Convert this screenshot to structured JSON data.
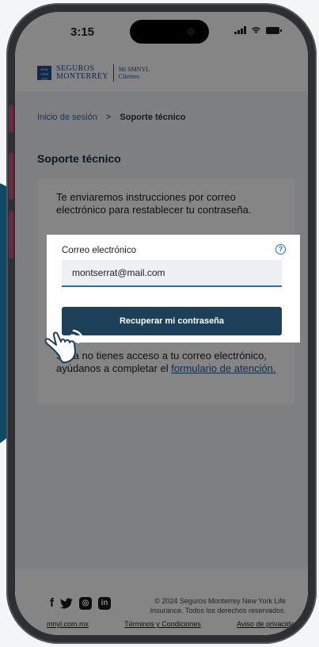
{
  "status_bar": {
    "time": "3:15"
  },
  "brand": {
    "logo_box": "NEW YORK LIFE",
    "name_line1": "SEGUROS",
    "name_line2": "MONTERREY",
    "product_line1": "Mi SMNYL",
    "product_line2": "Clientes"
  },
  "breadcrumb": {
    "home": "Inicio de sesión",
    "separator": ">",
    "current": "Soporte técnico"
  },
  "page": {
    "title": "Soporte técnico"
  },
  "card": {
    "intro": "Te enviaremos instrucciones por correo electrónico para restablecer tu contraseña.",
    "email_label": "Correo electrónico",
    "email_value": "montserrat@mail.com",
    "submit_label": "Recuperar mi contraseña",
    "help_text": "Si ya no tienes acceso a tu correo electrónico, ayúdanos a completar el ",
    "help_link": "formulario de atención."
  },
  "footer": {
    "copyright": "© 2024 Seguros Monterrey New York Life Insurance. Todos los derechos reservados.",
    "links": [
      "mnyl.com.mx",
      "Términos y Condiciones",
      "Aviso de privacidad"
    ],
    "social": [
      "facebook-icon",
      "twitter-icon",
      "instagram-icon",
      "linkedin-icon"
    ]
  },
  "colors": {
    "primary_button": "#1c3f5a",
    "link": "#2a6ca8",
    "brand": "#1f4e8c"
  }
}
